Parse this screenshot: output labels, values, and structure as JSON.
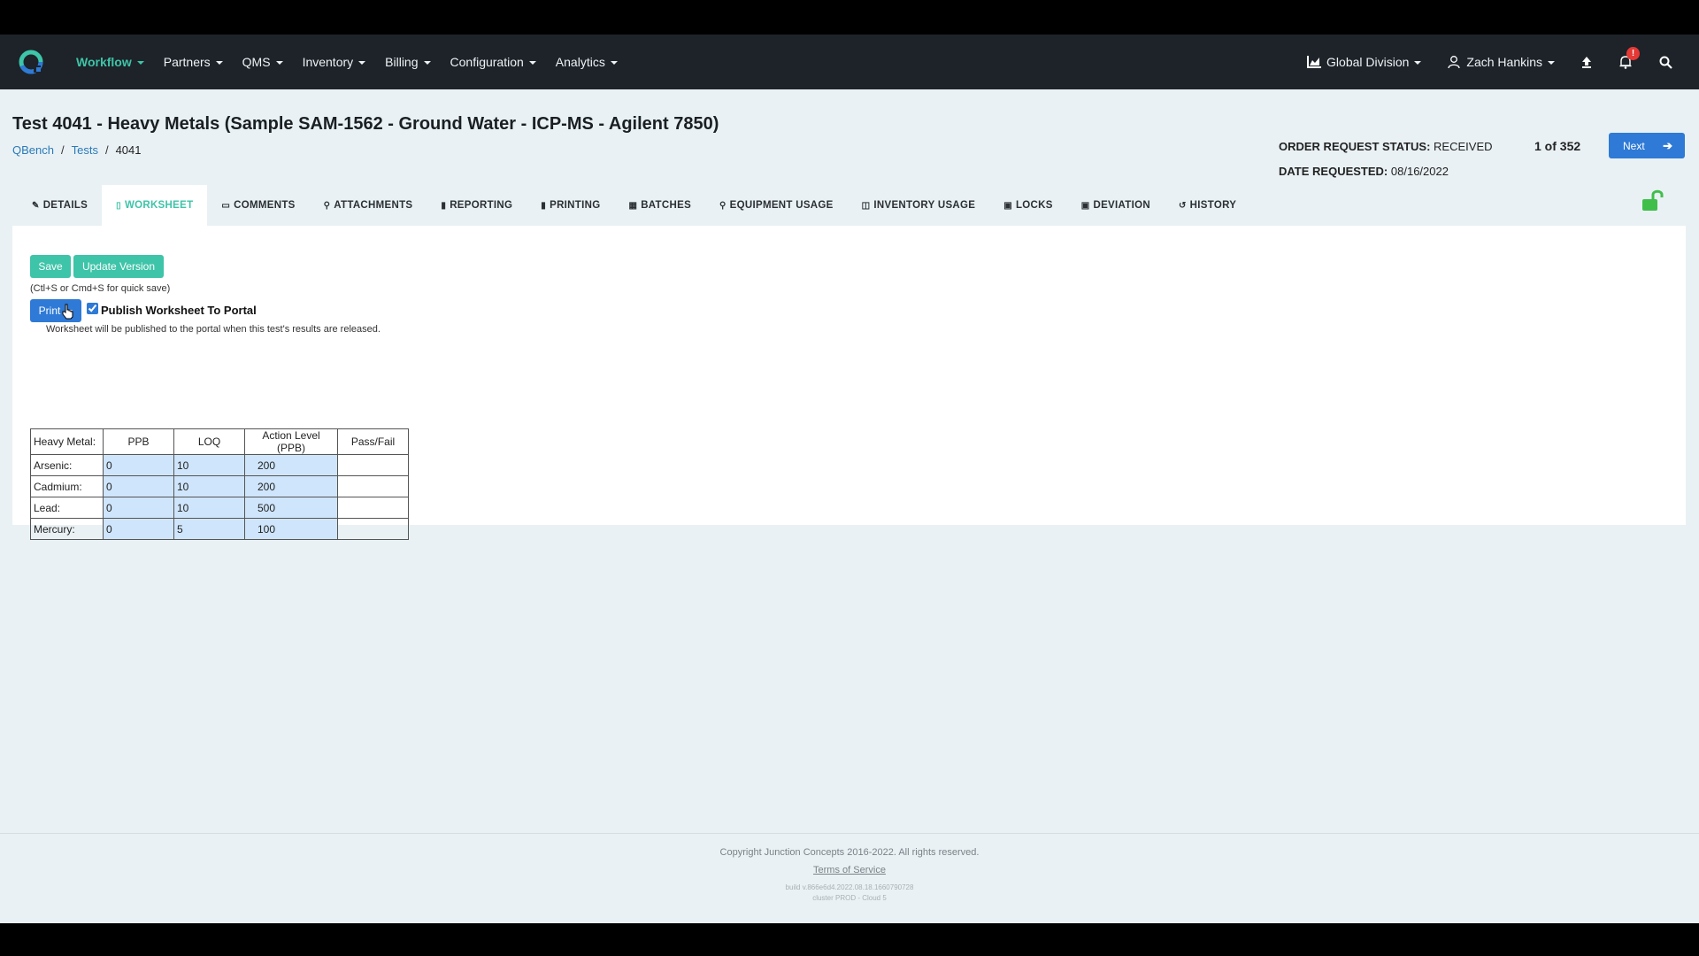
{
  "nav": {
    "menu": [
      {
        "label": "Workflow",
        "active": true
      },
      {
        "label": "Partners",
        "active": false
      },
      {
        "label": "QMS",
        "active": false
      },
      {
        "label": "Inventory",
        "active": false
      },
      {
        "label": "Billing",
        "active": false
      },
      {
        "label": "Configuration",
        "active": false
      },
      {
        "label": "Analytics",
        "active": false
      }
    ],
    "division": "Global Division",
    "user": "Zach Hankins",
    "notification_count": "!"
  },
  "page": {
    "title": "Test 4041 - Heavy Metals (Sample SAM-1562 - Ground Water - ICP-MS - Agilent 7850)",
    "breadcrumb": [
      "QBench",
      "Tests",
      "4041"
    ],
    "status_label": "ORDER REQUEST STATUS:",
    "status_value": "RECEIVED",
    "date_label": "DATE REQUESTED:",
    "date_value": "08/16/2022",
    "counter": "1 of 352",
    "next_label": "Next"
  },
  "tabs": [
    {
      "label": "DETAILS",
      "icon": "pencil-icon",
      "glyph": "✎"
    },
    {
      "label": "WORKSHEET",
      "icon": "document-icon",
      "glyph": "▯"
    },
    {
      "label": "COMMENTS",
      "icon": "comment-icon",
      "glyph": "▭"
    },
    {
      "label": "ATTACHMENTS",
      "icon": "paperclip-icon",
      "glyph": "⚲"
    },
    {
      "label": "REPORTING",
      "icon": "file-icon",
      "glyph": "▮"
    },
    {
      "label": "PRINTING",
      "icon": "file-icon",
      "glyph": "▮"
    },
    {
      "label": "BATCHES",
      "icon": "grid-icon",
      "glyph": "▦"
    },
    {
      "label": "EQUIPMENT USAGE",
      "icon": "map-marker-icon",
      "glyph": "⚲"
    },
    {
      "label": "INVENTORY USAGE",
      "icon": "box-icon",
      "glyph": "◫"
    },
    {
      "label": "LOCKS",
      "icon": "lock-icon",
      "glyph": "▣"
    },
    {
      "label": "DEVIATION",
      "icon": "alert-file-icon",
      "glyph": "▣"
    },
    {
      "label": "HISTORY",
      "icon": "history-icon",
      "glyph": "↺"
    }
  ],
  "active_tab": "WORKSHEET",
  "worksheet": {
    "save_label": "Save",
    "update_label": "Update Version",
    "hint": "(Ctl+S or Cmd+S for quick save)",
    "print_label": "Print",
    "publish_label": "Publish Worksheet To Portal",
    "publish_checked": true,
    "publish_note": "Worksheet will be published to the portal when this test's results are released.",
    "table": {
      "headers": [
        "Heavy Metal:",
        "PPB",
        "LOQ",
        "Action Level (PPB)",
        "Pass/Fail"
      ],
      "rows": [
        [
          "Arsenic:",
          "0",
          "10",
          "200",
          ""
        ],
        [
          "Cadmium:",
          "0",
          "10",
          "200",
          ""
        ],
        [
          "Lead:",
          "0",
          "10",
          "500",
          ""
        ],
        [
          "Mercury:",
          "0",
          "5",
          "100",
          ""
        ]
      ]
    }
  },
  "footer": {
    "copyright": "Copyright Junction Concepts 2016-2022. All rights reserved.",
    "tos": "Terms of Service",
    "build": "build v.866e6d4.2022.08.18.1660790728",
    "cluster": "cluster PROD - Cloud 5"
  },
  "colors": {
    "accent": "#3ec4a8",
    "primary": "#2e7ad6",
    "navbar": "#1d2329",
    "lock": "#3fbf4a"
  }
}
